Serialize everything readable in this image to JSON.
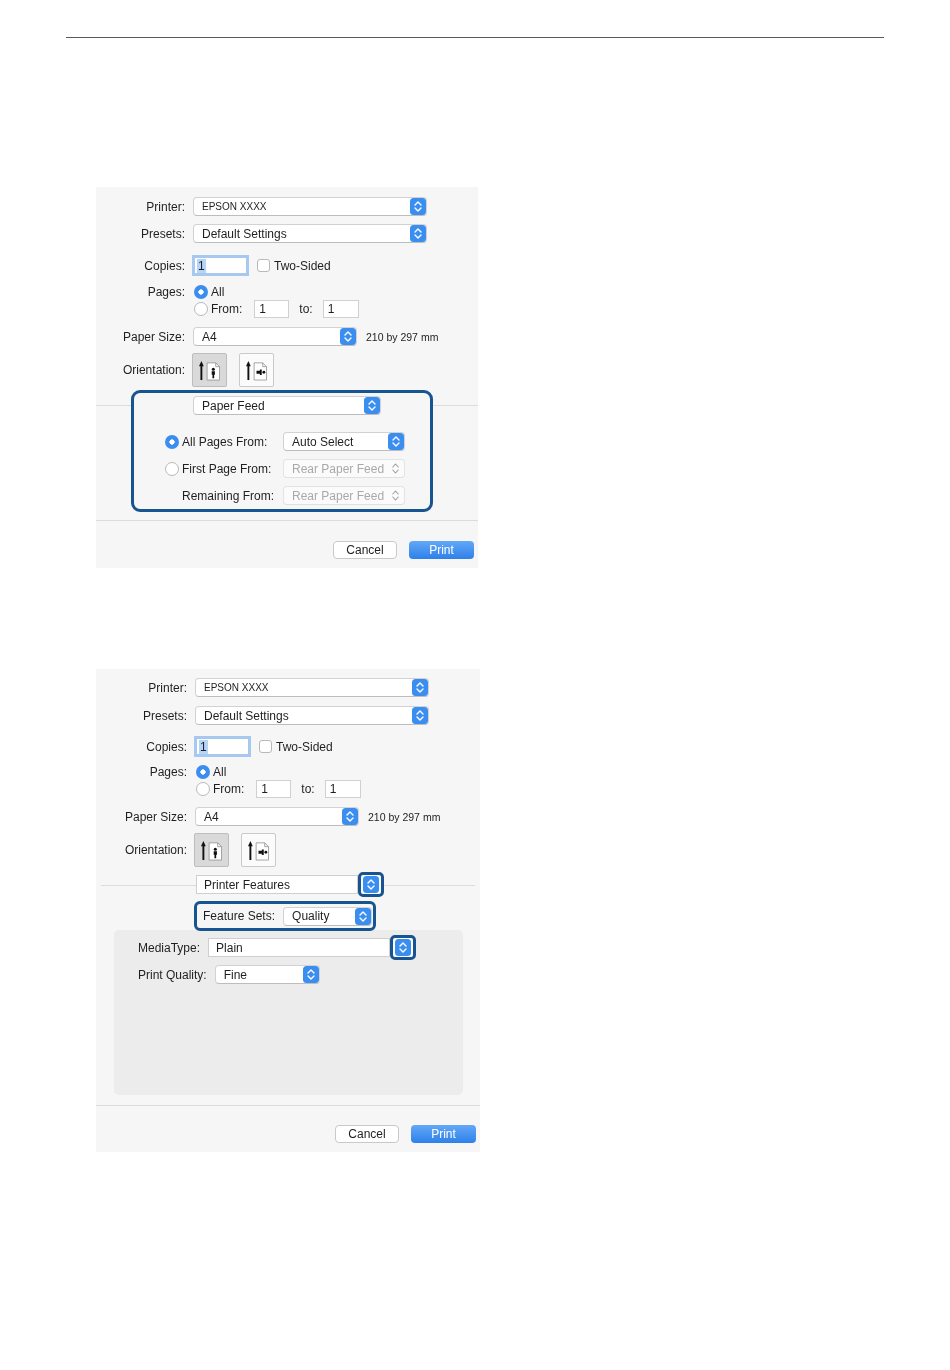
{
  "dialogs": [
    {
      "printer": {
        "label": "Printer:",
        "value": "EPSON XXXX"
      },
      "presets": {
        "label": "Presets:",
        "value": "Default Settings"
      },
      "copies": {
        "label": "Copies:",
        "value": "1",
        "focused": true
      },
      "two_sided": {
        "label": "Two-Sided",
        "checked": false
      },
      "pages": {
        "label": "Pages:",
        "options": [
          {
            "kind": "all",
            "label": "All",
            "selected": true
          },
          {
            "kind": "range",
            "label": "From:",
            "selected": false,
            "from": "1",
            "to_label": "to:",
            "to": "1"
          }
        ]
      },
      "paper_size": {
        "label": "Paper Size:",
        "value": "A4",
        "dimensions": "210 by 297 mm"
      },
      "orientation": {
        "label": "Orientation:",
        "options": [
          {
            "kind": "portrait",
            "selected": true
          },
          {
            "kind": "landscape",
            "selected": false
          }
        ]
      },
      "panel": {
        "kind": "paper_feed",
        "highlighted": true,
        "menu": {
          "value": "Paper Feed",
          "highlighted": false
        },
        "sources": [
          {
            "label": "All Pages From:",
            "selected": true,
            "value": "Auto Select",
            "disabled": false
          },
          {
            "label": "First Page From:",
            "selected": false,
            "value": "Rear Paper Feed",
            "disabled": true
          }
        ],
        "remaining": {
          "label": "Remaining From:",
          "value": "Rear Paper Feed",
          "disabled": true
        }
      },
      "buttons": [
        {
          "kind": "default",
          "label": "Cancel"
        },
        {
          "kind": "primary",
          "label": "Print"
        }
      ]
    },
    {
      "printer": {
        "label": "Printer:",
        "value": "EPSON XXXX"
      },
      "presets": {
        "label": "Presets:",
        "value": "Default Settings"
      },
      "copies": {
        "label": "Copies:",
        "value": "1",
        "focused": true
      },
      "two_sided": {
        "label": "Two-Sided",
        "checked": false
      },
      "pages": {
        "label": "Pages:",
        "options": [
          {
            "kind": "all",
            "label": "All",
            "selected": true
          },
          {
            "kind": "range",
            "label": "From:",
            "selected": false,
            "from": "1",
            "to_label": "to:",
            "to": "1"
          }
        ]
      },
      "paper_size": {
        "label": "Paper Size:",
        "value": "A4",
        "dimensions": "210 by 297 mm"
      },
      "orientation": {
        "label": "Orientation:",
        "options": [
          {
            "kind": "portrait",
            "selected": true
          },
          {
            "kind": "landscape",
            "selected": false
          }
        ]
      },
      "panel": {
        "kind": "printer_features",
        "highlighted": false,
        "menu": {
          "value": "Printer Features",
          "highlighted": true
        },
        "feature_sets": {
          "label": "Feature Sets:",
          "value": "Quality",
          "highlighted": true
        },
        "settings": [
          {
            "label": "MediaType:",
            "value": "Plain",
            "highlighted": true
          },
          {
            "label": "Print Quality:",
            "value": "Fine",
            "highlighted": false
          }
        ]
      },
      "buttons": [
        {
          "kind": "default",
          "label": "Cancel"
        },
        {
          "kind": "primary",
          "label": "Print"
        }
      ]
    }
  ]
}
